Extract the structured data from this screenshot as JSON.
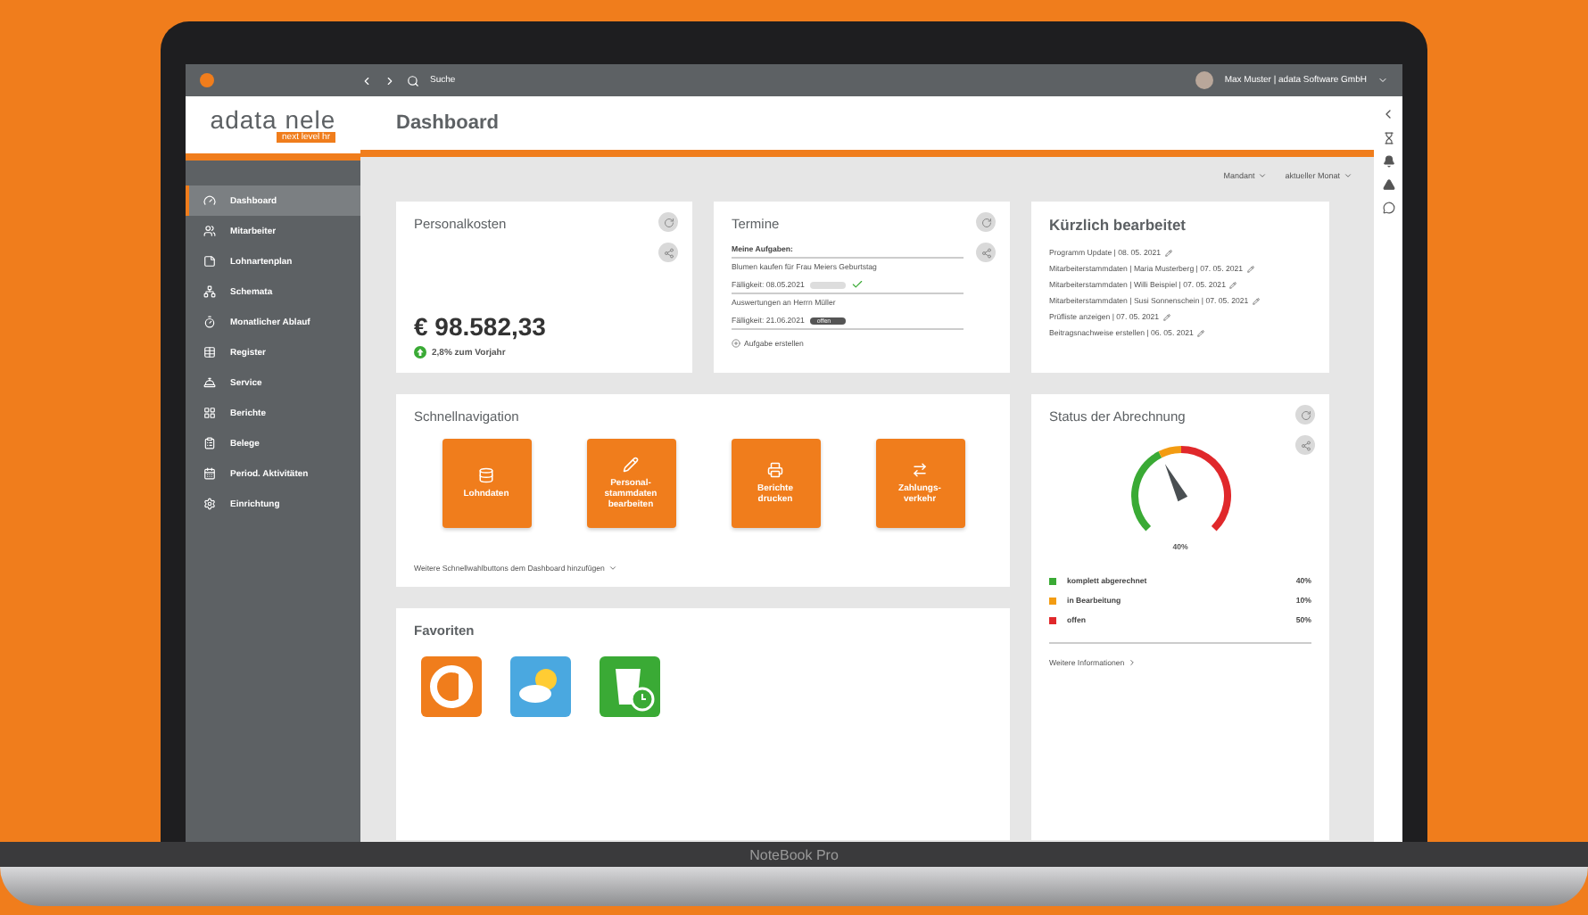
{
  "topbar": {
    "search": "Suche",
    "user": "Max Muster | adata Software GmbH"
  },
  "logo": {
    "name": "adata nele",
    "tagline": "next level hr"
  },
  "sidebar": {
    "items": [
      {
        "label": "Dashboard",
        "kind": "dashboard",
        "selected": true
      },
      {
        "label": "Mitarbeiter",
        "kind": "users",
        "selected": false
      },
      {
        "label": "Lohnartenplan",
        "kind": "note",
        "selected": false
      },
      {
        "label": "Schemata",
        "kind": "network",
        "selected": false
      },
      {
        "label": "Monatlicher Ablauf",
        "kind": "timer",
        "selected": false
      },
      {
        "label": "Register",
        "kind": "table",
        "selected": false
      },
      {
        "label": "Service",
        "kind": "bell",
        "selected": false
      },
      {
        "label": "Berichte",
        "kind": "grid",
        "selected": false
      },
      {
        "label": "Belege",
        "kind": "clipboard",
        "selected": false
      },
      {
        "label": "Period. Aktivitäten",
        "kind": "calendar",
        "selected": false
      },
      {
        "label": "Einrichtung",
        "kind": "settings",
        "selected": false
      }
    ]
  },
  "page_title": "Dashboard",
  "filters": [
    "Mandant",
    "aktueller Monat"
  ],
  "personalkosten": {
    "title": "Personalkosten",
    "amount": "€ 98.582,33",
    "trend": "2,8% zum Vorjahr"
  },
  "termine": {
    "title": "Termine",
    "heading": "Meine Aufgaben:",
    "tasks": [
      {
        "title": "Blumen kaufen für Frau Meiers Geburtstag",
        "due": "Fälligkeit: 08.05.2021",
        "done": true
      },
      {
        "title": "Auswertungen an Herrn Müller",
        "due": "Fälligkeit: 21.06.2021",
        "badge": "offen",
        "done": false
      }
    ],
    "add": "Aufgabe erstellen"
  },
  "recent": {
    "title": "Kürzlich bearbeitet",
    "items": [
      "Programm Update |  08. 05. 2021",
      "Mitarbeiterstammdaten | Maria Musterberg | 07. 05. 2021",
      "Mitarbeiterstammdaten | Willi Beispiel | 07. 05. 2021",
      "Mitarbeiterstammdaten | Susi Sonnenschein | 07. 05. 2021",
      "Prüfliste anzeigen |  07. 05. 2021",
      "Beitragsnachweise erstellen |  06. 05. 2021"
    ]
  },
  "quicknav": {
    "title": "Schnellnavigation",
    "buttons": [
      {
        "label": "Lohndaten",
        "kind": "database"
      },
      {
        "label": "Personal-\nstammdaten\nbearbeiten",
        "kind": "pencil"
      },
      {
        "label": "Berichte\ndrucken",
        "kind": "printer"
      },
      {
        "label": "Zahlungs-\nverkehr",
        "kind": "transfer"
      }
    ],
    "more": "Weitere Schnellwahlbuttons dem Dashboard hinzufügen"
  },
  "status": {
    "title": "Status der Abrechnung",
    "level": 0.4,
    "reading": "40%",
    "legend": [
      {
        "label": "komplett abgerechnet",
        "value": "40%",
        "color": "#3aaa35"
      },
      {
        "label": "in Bearbeitung",
        "value": "10%",
        "color": "#f39c12"
      },
      {
        "label": "offen",
        "value": "50%",
        "color": "#e0282b"
      }
    ],
    "more": "Weitere Informationen"
  },
  "favorites": {
    "title": "Favoriten",
    "apps": [
      {
        "kind": "adata"
      },
      {
        "kind": "weather"
      },
      {
        "kind": "drink"
      }
    ]
  },
  "laptop_label": "NoteBook Pro"
}
